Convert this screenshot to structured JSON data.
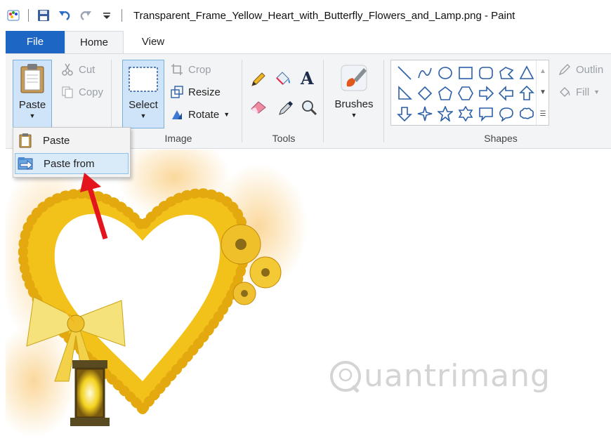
{
  "window": {
    "title": "Transparent_Frame_Yellow_Heart_with_Butterfly_Flowers_and_Lamp.png - Paint"
  },
  "tabs": [
    {
      "label": "File"
    },
    {
      "label": "Home"
    },
    {
      "label": "View"
    }
  ],
  "ribbon": {
    "clipboard": {
      "paste_label": "Paste",
      "cut_label": "Cut",
      "copy_label": "Copy"
    },
    "image": {
      "group_label": "Image",
      "select_label": "Select",
      "crop_label": "Crop",
      "resize_label": "Resize",
      "rotate_label": "Rotate"
    },
    "tools": {
      "group_label": "Tools"
    },
    "brushes": {
      "label": "Brushes"
    },
    "shapes": {
      "group_label": "Shapes",
      "outline_label": "Outlin",
      "fill_label": "Fill"
    }
  },
  "paste_menu": {
    "items": [
      {
        "label": "Paste"
      },
      {
        "label": "Paste from"
      }
    ]
  },
  "watermark": {
    "text": "uantrimang"
  },
  "colors": {
    "file_tab": "#1e66c4",
    "ribbon_bg": "#f3f4f6",
    "selected_btn": "#cfe4f8",
    "highlight": "#d9eaf9",
    "arrow": "#e3141e",
    "heart_gold": "#f2c21b"
  }
}
